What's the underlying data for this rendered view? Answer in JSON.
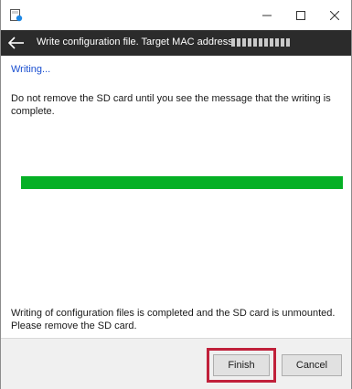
{
  "window": {
    "app_icon": "sd-card-app-icon",
    "controls": {
      "minimize_icon": "minimize-icon",
      "maximize_icon": "maximize-icon",
      "close_icon": "close-icon"
    }
  },
  "header": {
    "back_icon": "back-arrow-icon",
    "title": "Write configuration file. Target MAC address:"
  },
  "content": {
    "status": "Writing...",
    "warning": "Do not remove the SD card until you see the message that the writing is complete.",
    "progress": 1.0,
    "complete_message": "Writing of configuration files is completed and the SD card is unmounted. Please remove the SD card."
  },
  "footer": {
    "finish_label": "Finish",
    "cancel_label": "Cancel"
  },
  "colors": {
    "header_bg": "#2b2b2b",
    "progress_fill": "#06b025",
    "link": "#1a4fd0",
    "highlight": "#c0203a"
  }
}
